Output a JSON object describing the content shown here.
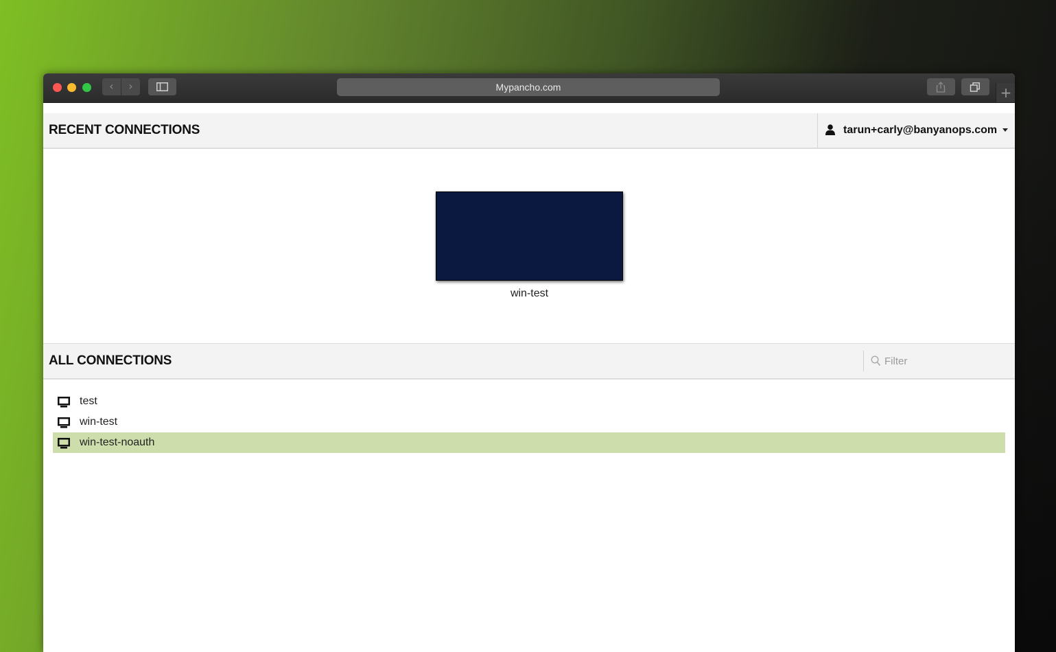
{
  "browser": {
    "url": "Mypancho.com",
    "back_label": "‹",
    "forward_label": "›",
    "new_tab_label": "+"
  },
  "recent": {
    "title": "RECENT CONNECTIONS",
    "items": [
      {
        "label": "win-test",
        "thumbnail_color": "#0b1941"
      }
    ]
  },
  "user": {
    "email": "tarun+carly@banyanops.com"
  },
  "all": {
    "title": "ALL CONNECTIONS",
    "filter_placeholder": "Filter",
    "items": [
      {
        "label": "test",
        "selected": false
      },
      {
        "label": "win-test",
        "selected": false
      },
      {
        "label": "win-test-noauth",
        "selected": true
      }
    ]
  },
  "colors": {
    "selected_row": "#cddeac",
    "header_bg": "#f3f3f3"
  }
}
